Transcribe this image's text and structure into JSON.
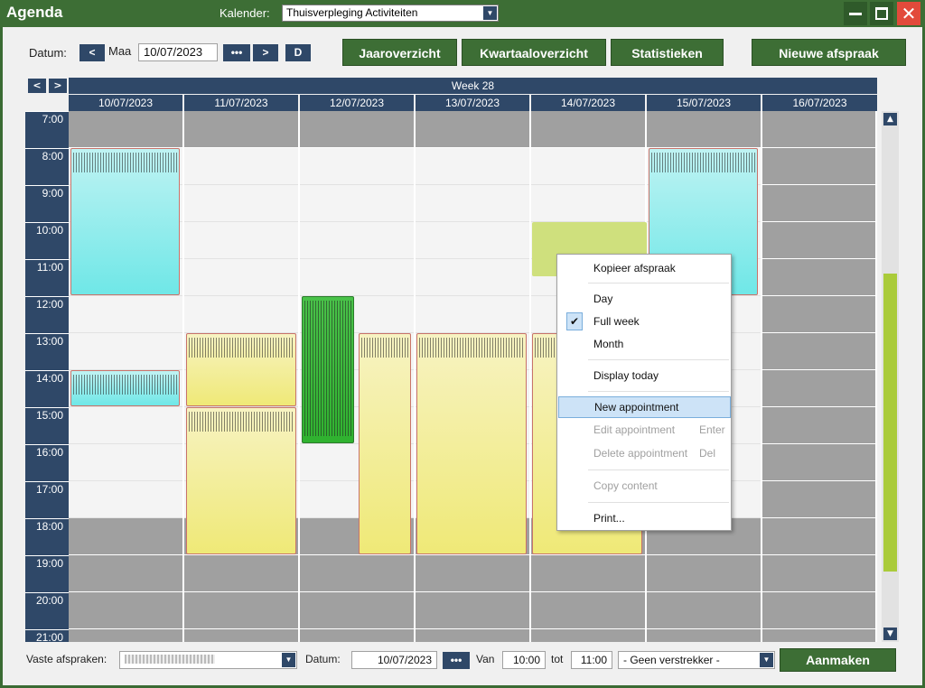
{
  "window": {
    "title": "Agenda",
    "calendar_label": "Kalender:",
    "calendar_value": "Thuisverpleging Activiteiten"
  },
  "toolbar": {
    "date_label": "Datum:",
    "prev_label": "<",
    "day_name": "Maa",
    "date_value": "10/07/2023",
    "dots_label": "•••",
    "next_label": ">",
    "d_label": "D",
    "buttons": [
      "Jaaroverzicht",
      "Kwartaaloverzicht",
      "Statistieken",
      "Nieuwe afspraak"
    ]
  },
  "calendar": {
    "week_label": "Week 28",
    "prev_arrow": "<",
    "next_arrow": ">",
    "days": [
      "10/07/2023",
      "11/07/2023",
      "12/07/2023",
      "13/07/2023",
      "14/07/2023",
      "15/07/2023",
      "16/07/2023"
    ],
    "hours": [
      "7:00",
      "8:00",
      "9:00",
      "10:00",
      "11:00",
      "12:00",
      "13:00",
      "14:00",
      "15:00",
      "16:00",
      "17:00",
      "18:00",
      "19:00",
      "20:00",
      "21:00"
    ]
  },
  "context_menu": {
    "items": [
      {
        "label": "Kopieer afspraak",
        "shortcut": "",
        "enabled": true
      },
      {
        "label": "Day",
        "shortcut": "",
        "enabled": true
      },
      {
        "label": "Full week",
        "shortcut": "",
        "enabled": true,
        "checked": true
      },
      {
        "label": "Month",
        "shortcut": "",
        "enabled": true
      },
      {
        "label": "Display today",
        "shortcut": "",
        "enabled": true
      },
      {
        "label": "New appointment",
        "shortcut": "",
        "enabled": true,
        "highlighted": true
      },
      {
        "label": "Edit appointment",
        "shortcut": "Enter",
        "enabled": false
      },
      {
        "label": "Delete appointment",
        "shortcut": "Del",
        "enabled": false
      },
      {
        "label": "Copy content",
        "shortcut": "",
        "enabled": false
      },
      {
        "label": "Print...",
        "shortcut": "",
        "enabled": true
      }
    ]
  },
  "bottom": {
    "fixed_label": "Vaste afspraken:",
    "date_label": "Datum:",
    "date_value": "10/07/2023",
    "dots_label": "•••",
    "from_label": "Van",
    "from_value": "10:00",
    "to_label": "tot",
    "to_value": "11:00",
    "provider_value": "- Geen verstrekker -",
    "create_label": "Aanmaken"
  },
  "colors": {
    "titlebar": "#3d6e35",
    "navy": "#2f4868",
    "accent_green": "#3d6e35",
    "appt_cyan": "#6fe7e7",
    "appt_yellow": "#efe977",
    "appt_green": "#2fb22f",
    "scroll_thumb": "#aacb3a"
  }
}
